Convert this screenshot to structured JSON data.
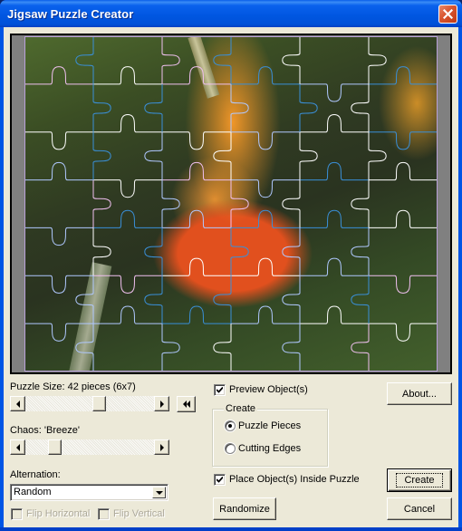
{
  "window": {
    "title": "Jigsaw Puzzle Creator",
    "close_icon": "close-icon"
  },
  "preview": {
    "description": "Photo of an orange jewelweed flower overlaid with jigsaw cut lines",
    "columns": 6,
    "rows": 7,
    "line_colors": [
      "#ffffff",
      "#b0c8ff",
      "#f0c0f0",
      "#3a8fd8"
    ]
  },
  "puzzle_size": {
    "label": "Puzzle Size: 42 pieces (6x7)",
    "slider_fraction": 0.58,
    "reset_icon": "rewind-icon"
  },
  "chaos": {
    "label": "Chaos: 'Breeze'",
    "slider_fraction": 0.2
  },
  "alternation": {
    "label": "Alternation:",
    "selected": "Random"
  },
  "flip_horizontal": {
    "label": "Flip Horizontal",
    "checked": false,
    "enabled": false
  },
  "flip_vertical": {
    "label": "Flip Vertical",
    "checked": false,
    "enabled": false
  },
  "preview_objects": {
    "label": "Preview Object(s)",
    "checked": true
  },
  "create_group": {
    "legend": "Create",
    "options": [
      {
        "label": "Puzzle Pieces",
        "selected": true
      },
      {
        "label": "Cutting Edges",
        "selected": false
      }
    ]
  },
  "place_inside": {
    "label": "Place Object(s) Inside Puzzle",
    "checked": true
  },
  "buttons": {
    "about": "About...",
    "randomize": "Randomize",
    "create": "Create",
    "cancel": "Cancel"
  }
}
